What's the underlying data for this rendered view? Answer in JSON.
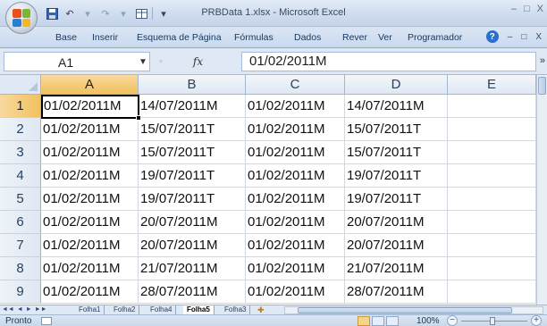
{
  "window": {
    "title": "PRBData 1.xlsx - Microsoft Excel",
    "controls": [
      "–",
      "□",
      "X"
    ]
  },
  "quick_access": {
    "save_icon": "save-icon",
    "undo_icon": "undo-icon",
    "redo_icon": "redo-icon",
    "customize_icon": "customize-icon"
  },
  "ribbon": {
    "tabs": [
      "Base",
      "Inserir",
      "Esquema de Página",
      "Fórmulas",
      "Dados",
      "Rever",
      "Ver",
      "Programador"
    ],
    "right_controls": [
      "–",
      "□",
      "X"
    ]
  },
  "formula_bar": {
    "name_box": "A1",
    "fx_label": "fx",
    "formula": "01/02/2011M"
  },
  "grid": {
    "columns": [
      "A",
      "B",
      "C",
      "D",
      "E"
    ],
    "selected_column": "A",
    "selected_row": "1",
    "rows": [
      {
        "num": "1",
        "cells": [
          "01/02/2011M",
          "14/07/2011M",
          "01/02/2011M",
          "14/07/2011M",
          ""
        ]
      },
      {
        "num": "2",
        "cells": [
          "01/02/2011M",
          "15/07/2011T",
          "01/02/2011M",
          "15/07/2011T",
          ""
        ]
      },
      {
        "num": "3",
        "cells": [
          "01/02/2011M",
          "15/07/2011T",
          "01/02/2011M",
          "15/07/2011T",
          ""
        ]
      },
      {
        "num": "4",
        "cells": [
          "01/02/2011M",
          "19/07/2011T",
          "01/02/2011M",
          "19/07/2011T",
          ""
        ]
      },
      {
        "num": "5",
        "cells": [
          "01/02/2011M",
          "19/07/2011T",
          "01/02/2011M",
          "19/07/2011T",
          ""
        ]
      },
      {
        "num": "6",
        "cells": [
          "01/02/2011M",
          "20/07/2011M",
          "01/02/2011M",
          "20/07/2011M",
          ""
        ]
      },
      {
        "num": "7",
        "cells": [
          "01/02/2011M",
          "20/07/2011M",
          "01/02/2011M",
          "20/07/2011M",
          ""
        ]
      },
      {
        "num": "8",
        "cells": [
          "01/02/2011M",
          "21/07/2011M",
          "01/02/2011M",
          "21/07/2011M",
          ""
        ]
      },
      {
        "num": "9",
        "cells": [
          "01/02/2011M",
          "28/07/2011M",
          "01/02/2011M",
          "28/07/2011M",
          ""
        ]
      }
    ]
  },
  "sheet_tabs": {
    "nav": [
      "◄◄",
      "◄",
      "►",
      "►►"
    ],
    "tabs": [
      "Folha1",
      "Folha2",
      "Folha4",
      "Folha5",
      "Folha3"
    ],
    "active": "Folha5"
  },
  "status_bar": {
    "status": "Pronto",
    "zoom": "100%",
    "zoom_minus": "−",
    "zoom_plus": "+"
  },
  "colors": {
    "selection_header": "#f1c15f",
    "ribbon_blue": "#c9d9ee",
    "gridline": "#d0d7e5"
  }
}
